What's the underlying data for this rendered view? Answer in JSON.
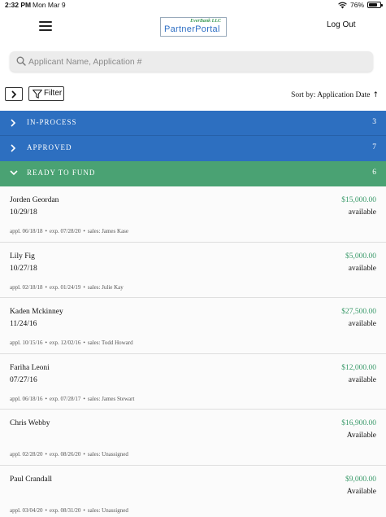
{
  "status_bar": {
    "time": "2:32 PM",
    "date": "Mon Mar 9",
    "battery": "76%",
    "battery_level": 0.76
  },
  "header": {
    "logo_top": "EverBank LLC",
    "logo_main": "PartnerPortal",
    "logout_label": "Log Out"
  },
  "search": {
    "placeholder": "Applicant Name, Application #"
  },
  "toolbar": {
    "filter_label": "Filter",
    "sort_label": "Sort by: Application Date",
    "sort_arrow": "↑"
  },
  "colors": {
    "in_process": "#2d6fc0",
    "approved": "#2d6fc0",
    "ready_to_fund": "#4aa273",
    "amount_green": "#3a9a6a"
  },
  "sections": [
    {
      "label": "IN-PROCESS",
      "count": "3"
    },
    {
      "label": "APPROVED",
      "count": "7"
    },
    {
      "label": "READY TO FUND",
      "count": "6"
    }
  ],
  "applications": [
    {
      "name": "Jorden Geordan",
      "date": "10/29/18",
      "amount": "$15,000.00",
      "availability": "available",
      "appl": "appl. 06/18/18",
      "exp": "exp. 07/28/20",
      "sales": "sales: James Kase"
    },
    {
      "name": "Lily Fig",
      "date": "10/27/18",
      "amount": "$5,000.00",
      "availability": "available",
      "appl": "appl. 02/18/18",
      "exp": "exp. 01/24/19",
      "sales": "sales: Julie Kay"
    },
    {
      "name": "Kaden Mckinney",
      "date": "11/24/16",
      "amount": "$27,500.00",
      "availability": "available",
      "appl": "appl. 10/15/16",
      "exp": "exp. 12/02/16",
      "sales": "sales: Todd Howard"
    },
    {
      "name": "Fariha Leoni",
      "date": "07/27/16",
      "amount": "$12,000.00",
      "availability": "available",
      "appl": "appl. 06/18/16",
      "exp": "exp. 07/28/17",
      "sales": "sales: James Stewart"
    },
    {
      "name": "Chris Webby",
      "date": "",
      "amount": "$16,900.00",
      "availability": "Available",
      "appl": "appl. 02/28/20",
      "exp": "exp. 08/26/20",
      "sales": "sales: Unassigned"
    },
    {
      "name": "Paul Crandall",
      "date": "",
      "amount": "$9,000.00",
      "availability": "Available",
      "appl": "appl. 03/04/20",
      "exp": "exp. 08/31/20",
      "sales": "sales: Unassigned"
    }
  ]
}
